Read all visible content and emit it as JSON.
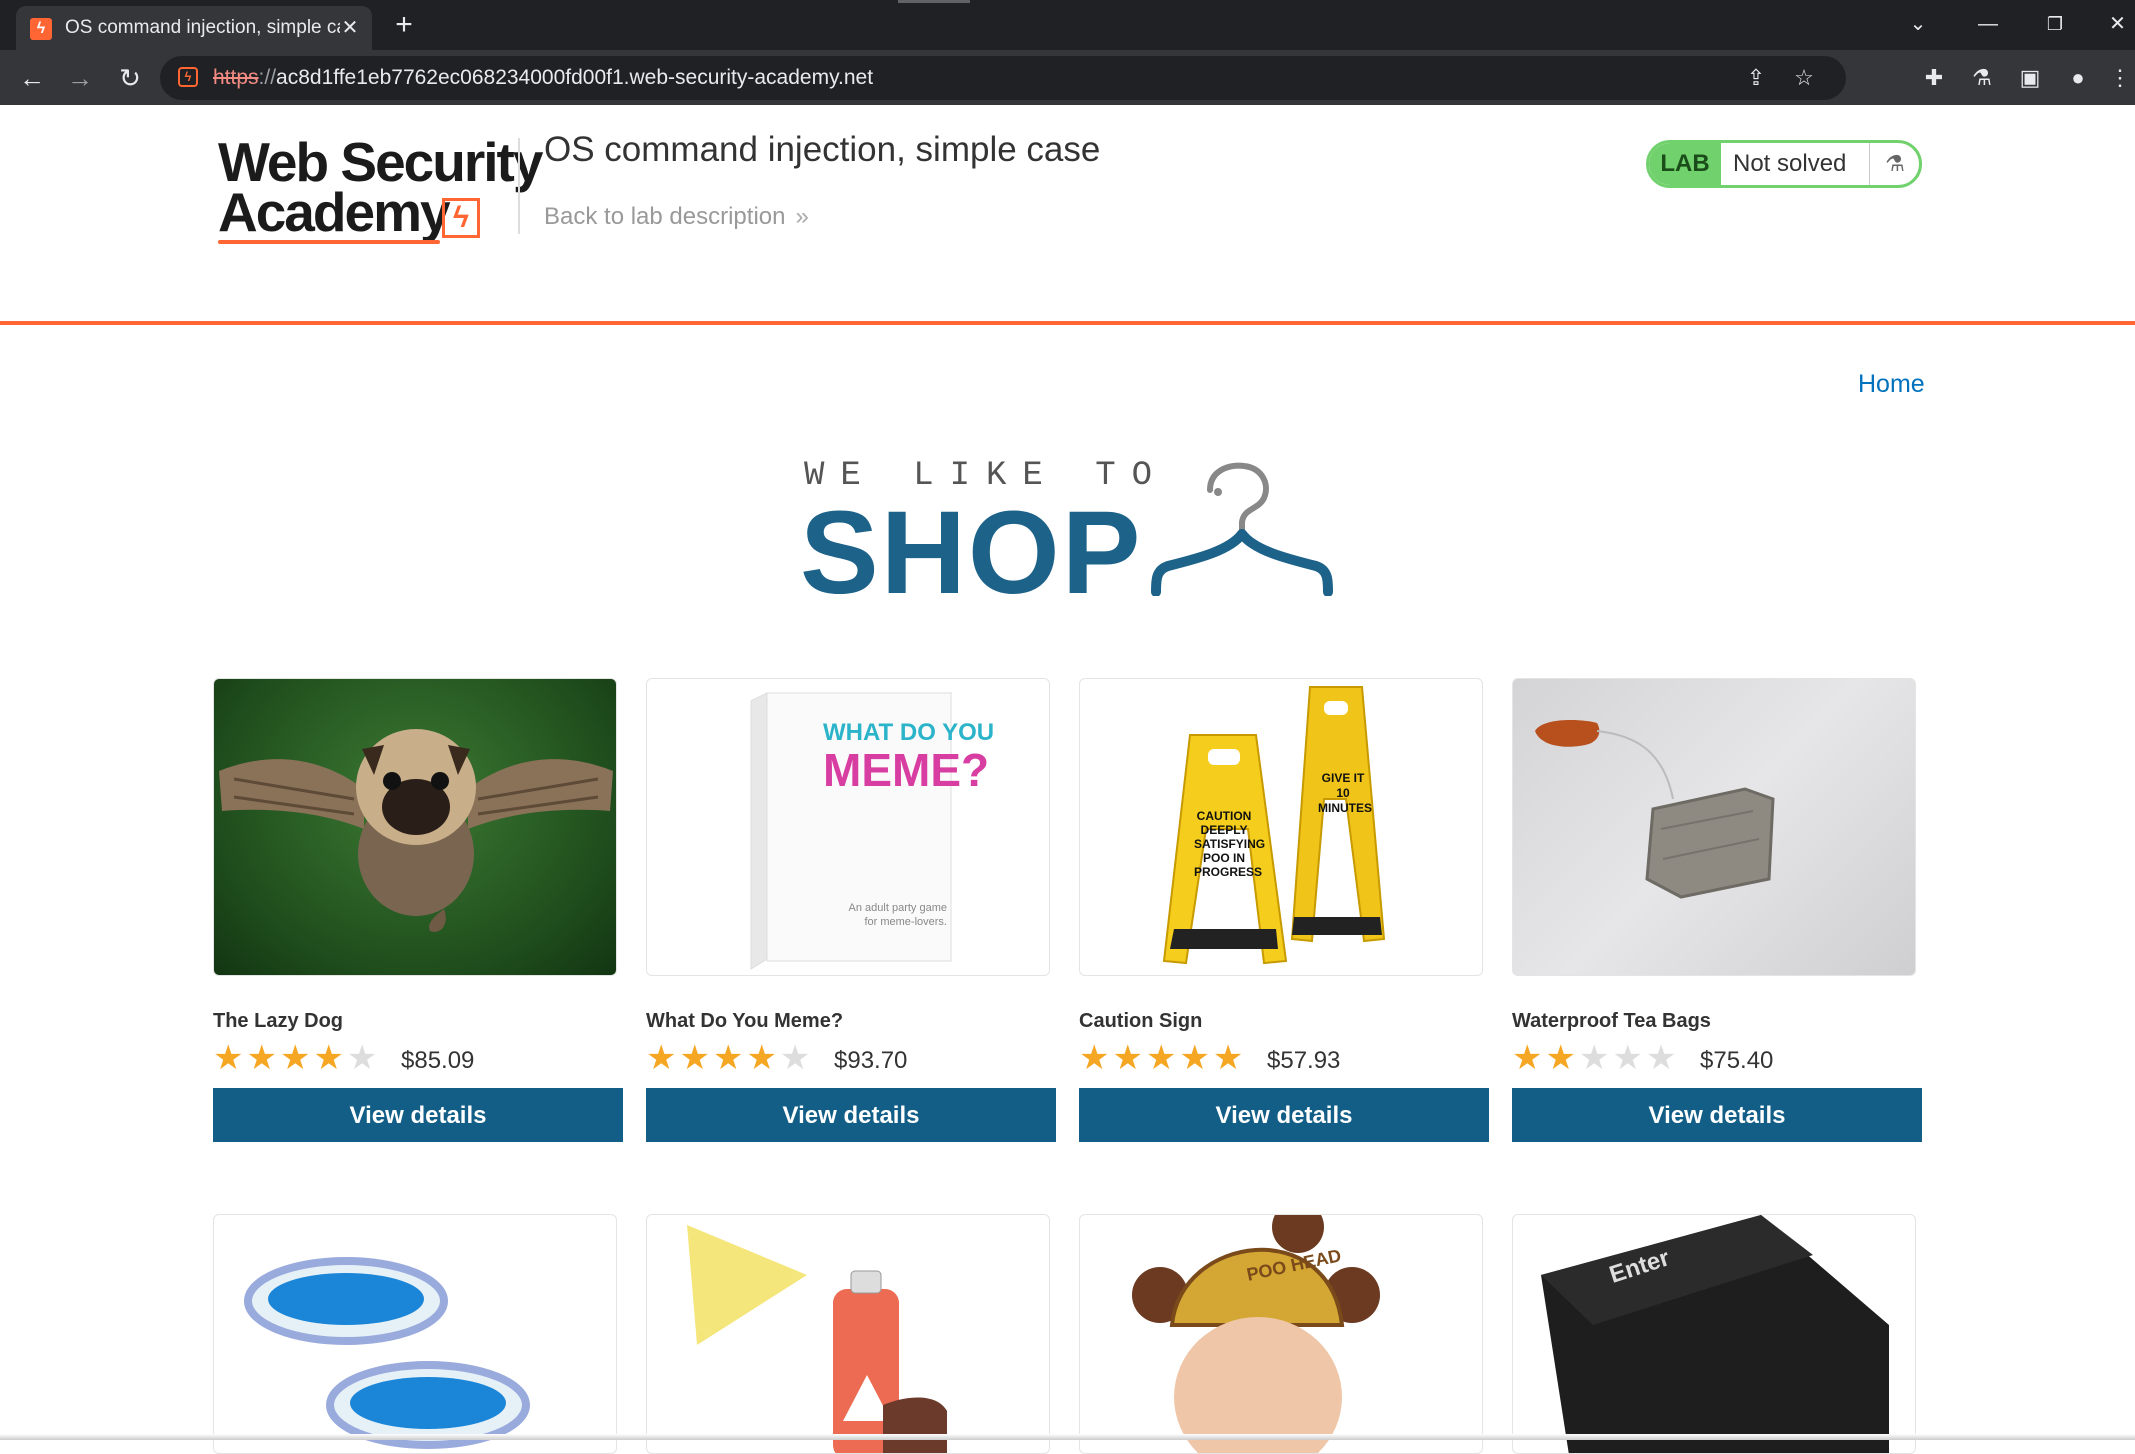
{
  "browser": {
    "tab_title": "OS command injection, simple case",
    "new_tab": "+",
    "url_scheme": "https",
    "url_rest": "ac8d1ffe1eb7762ec068234000fd00f1.web-security-academy.net"
  },
  "header": {
    "logo_line1": "Web Security",
    "logo_line2": "Academy",
    "lab_title": "OS command injection, simple case",
    "back_link": "Back to lab description",
    "status_badge": "LAB",
    "status_text": "Not solved"
  },
  "nav": {
    "home": "Home"
  },
  "banner": {
    "tagline": "WE LIKE TO",
    "word": "SHOP"
  },
  "products": [
    {
      "name": "The Lazy Dog",
      "rating": 4,
      "price": "$85.09",
      "button": "View details"
    },
    {
      "name": "What Do You Meme?",
      "rating": 4,
      "price": "$93.70",
      "button": "View details",
      "box_top": "WHAT DO YOU",
      "box_main": "MEME?",
      "box_sub": "An adult party game for meme-lovers."
    },
    {
      "name": "Caution Sign",
      "rating": 5,
      "price": "$57.93",
      "button": "View details",
      "sign_left": "CAUTION DEEPLY SATISFYING POO IN PROGRESS",
      "sign_right": "GIVE IT 10 MINUTES"
    },
    {
      "name": "Waterproof Tea Bags",
      "rating": 2,
      "price": "$75.40",
      "button": "View details"
    }
  ],
  "second_row": {
    "hat_text": "POO HEAD",
    "key_text": "Enter"
  },
  "colors": {
    "accent": "#ff6633",
    "primary_button": "#125e87",
    "shop_blue": "#1d6289",
    "star": "#f5a623",
    "status_green": "#70d16d"
  }
}
